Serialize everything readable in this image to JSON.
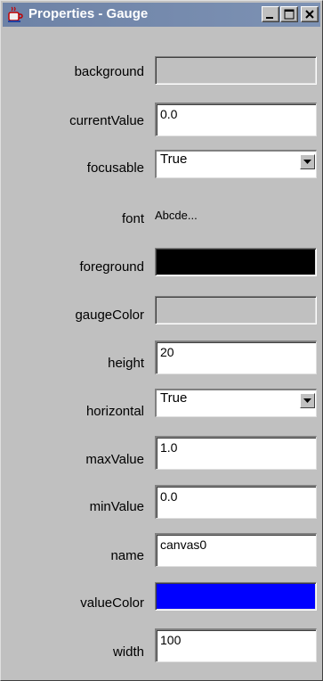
{
  "window": {
    "title": "Properties - Gauge",
    "controls": {
      "minimize": "minimize-icon",
      "maximize": "maximize-icon",
      "close": "close-icon"
    }
  },
  "properties": {
    "background": {
      "label": "background",
      "color": "#c0c0c0"
    },
    "currentValue": {
      "label": "currentValue",
      "value": "0.0"
    },
    "focusable": {
      "label": "focusable",
      "value": "True"
    },
    "font": {
      "label": "font",
      "value": "Abcde..."
    },
    "foreground": {
      "label": "foreground",
      "color": "#000000"
    },
    "gaugeColor": {
      "label": "gaugeColor",
      "color": "#c0c0c0"
    },
    "height": {
      "label": "height",
      "value": "20"
    },
    "horizontal": {
      "label": "horizontal",
      "value": "True"
    },
    "maxValue": {
      "label": "maxValue",
      "value": "1.0"
    },
    "minValue": {
      "label": "minValue",
      "value": "0.0"
    },
    "name": {
      "label": "name",
      "value": "canvas0"
    },
    "valueColor": {
      "label": "valueColor",
      "color": "#0000ff"
    },
    "width": {
      "label": "width",
      "value": "100"
    }
  }
}
